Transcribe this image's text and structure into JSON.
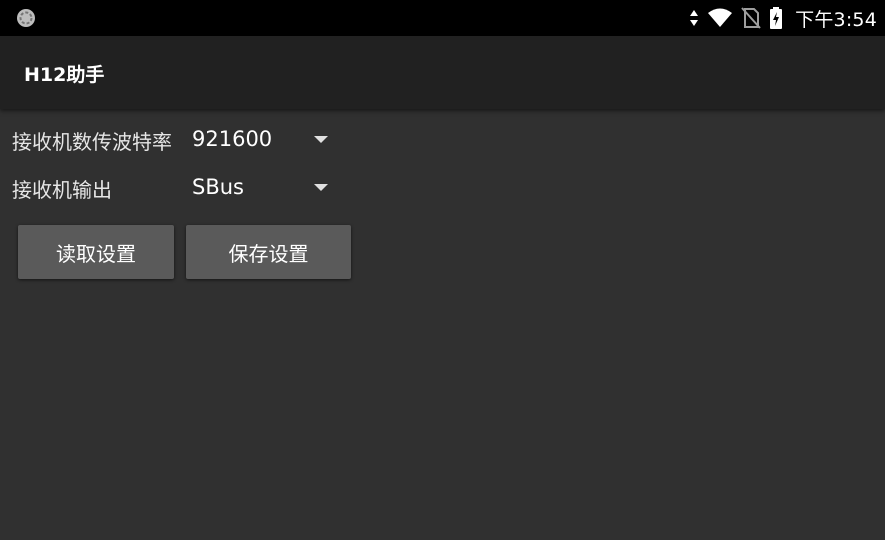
{
  "status_bar": {
    "time": "下午3:54",
    "icons": [
      "sync-icon",
      "data-arrows-icon",
      "wifi-icon",
      "no-sim-icon",
      "battery-charging-icon"
    ]
  },
  "app_bar": {
    "title": "H12助手"
  },
  "settings": {
    "baud_rate": {
      "label": "接收机数传波特率",
      "value": "921600"
    },
    "output": {
      "label": "接收机输出",
      "value": "SBus"
    }
  },
  "buttons": {
    "read_label": "读取设置",
    "save_label": "保存设置"
  },
  "colors": {
    "background": "#303030",
    "app_bar": "#212121",
    "status_bar": "#000000",
    "button": "#5a5a5a"
  }
}
